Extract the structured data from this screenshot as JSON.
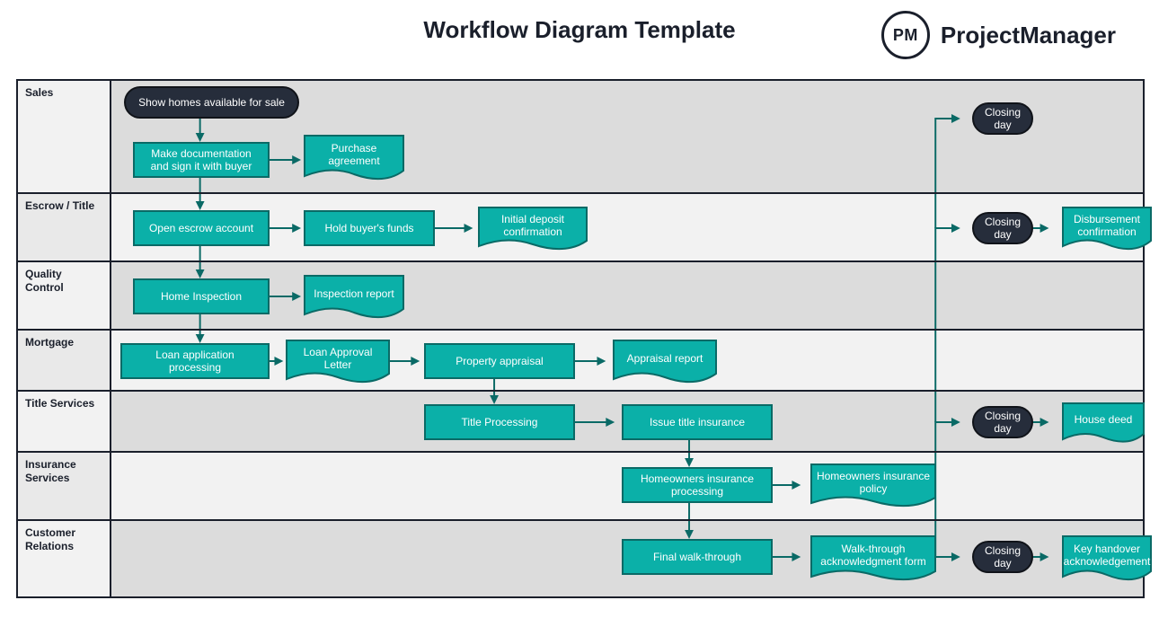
{
  "title": "Workflow Diagram Template",
  "brand": {
    "logo_text": "PM",
    "name": "ProjectManager"
  },
  "colors": {
    "process_fill": "#0bb0a8",
    "process_border": "#0a6a66",
    "terminator_fill": "#262d3b",
    "terminator_border": "#101319",
    "arrow": "#0a6a66",
    "lane_odd": "#dcdcdc",
    "lane_even": "#f2f2f2"
  },
  "lanes": [
    {
      "name": "Sales"
    },
    {
      "name": "Escrow / Title"
    },
    {
      "name": "Quality Control"
    },
    {
      "name": "Mortgage"
    },
    {
      "name": "Title Services"
    },
    {
      "name": "Insurance Services"
    },
    {
      "name": "Customer Relations"
    }
  ],
  "nodes": {
    "start": "Show homes available for sale",
    "make_doc": "Make documentation and sign it with buyer",
    "purchase_agreement": "Purchase agreement",
    "open_escrow": "Open escrow account",
    "hold_funds": "Hold buyer's funds",
    "initial_deposit": "Initial deposit confirmation",
    "home_inspection": "Home Inspection",
    "inspection_report": "Inspection report",
    "loan_processing": "Loan application processing",
    "loan_approval": "Loan Approval Letter",
    "property_appraisal": "Property appraisal",
    "appraisal_report": "Appraisal report",
    "title_processing": "Title Processing",
    "issue_title_ins": "Issue title insurance",
    "homeowners_proc": "Homeowners insurance processing",
    "homeowners_policy": "Homeowners insurance policy",
    "final_walk": "Final walk-through",
    "walk_ack": "Walk-through acknowledgment form",
    "closing_cr": "Closing day",
    "key_handover": "Key handover acknowledgement",
    "closing_sales": "Closing day",
    "closing_escrow": "Closing day",
    "disbursement": "Disbursement confirmation",
    "closing_title": "Closing day",
    "house_deed": "House deed"
  }
}
